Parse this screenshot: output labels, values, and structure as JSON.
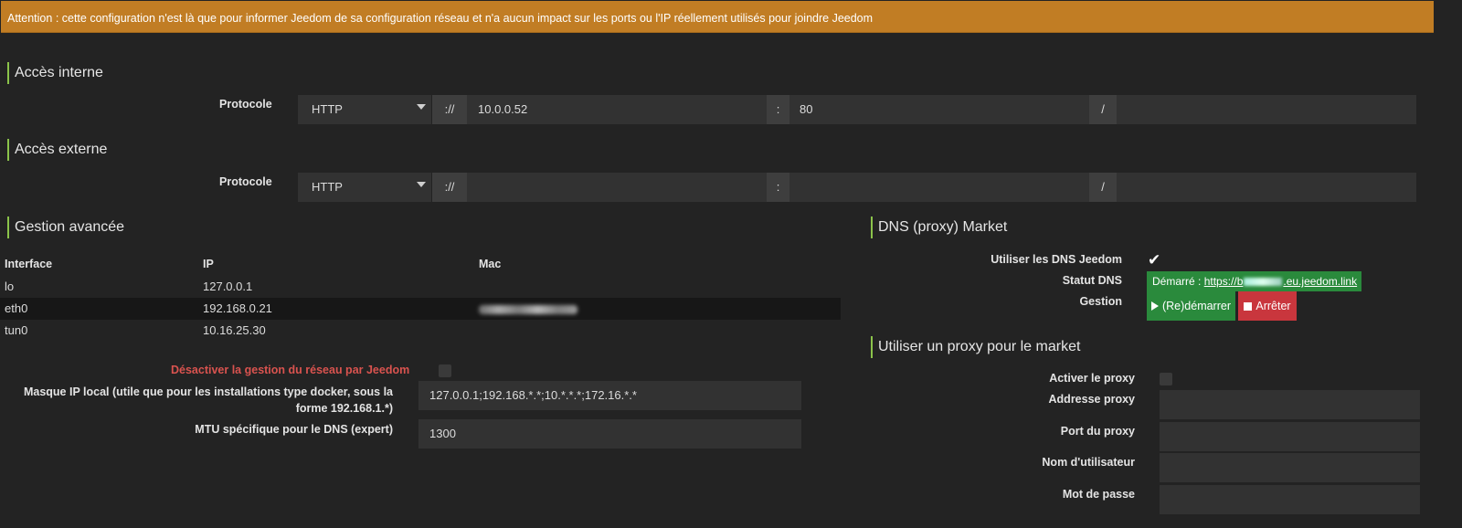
{
  "alert": {
    "text": "Attention : cette configuration n'est là que pour informer Jeedom de sa configuration réseau et n'a aucun impact sur les ports ou l'IP réellement utilisés pour joindre Jeedom"
  },
  "internal": {
    "title": "Accès interne",
    "protocol_label": "Protocole",
    "protocol": "HTTP",
    "sep_scheme": "://",
    "ip": "10.0.0.52",
    "sep_port": ":",
    "port": "80",
    "sep_path": "/",
    "path": ""
  },
  "external": {
    "title": "Accès externe",
    "protocol_label": "Protocole",
    "protocol": "HTTP",
    "sep_scheme": "://",
    "ip": "",
    "sep_port": ":",
    "port": "",
    "sep_path": "/",
    "path": ""
  },
  "advanced": {
    "title": "Gestion avancée",
    "columns": [
      "Interface",
      "IP",
      "Mac"
    ],
    "rows": [
      {
        "interface": "lo",
        "ip": "127.0.0.1",
        "mac": ""
      },
      {
        "interface": "eth0",
        "ip": "192.168.0.21",
        "mac": ""
      },
      {
        "interface": "tun0",
        "ip": "10.16.25.30",
        "mac": ""
      }
    ],
    "disable_label": "Désactiver la gestion du réseau par Jeedom",
    "mask_label_line1": "Masque IP local (utile que pour les installations type docker, sous la",
    "mask_label_line2": "forme 192.168.1.*)",
    "mask_value": "127.0.0.1;192.168.*.*;10.*.*.*;172.16.*.*",
    "mtu_label": "MTU spécifique pour le DNS (expert)",
    "mtu_value": "1300"
  },
  "dns": {
    "title": "DNS (proxy) Market",
    "use_dns_label": "Utiliser les DNS Jeedom",
    "status_label": "Statut DNS",
    "status_prefix": "Démarré : ",
    "status_link_start": "https://b",
    "status_link_end": ".eu.jeedom.link",
    "manage_label": "Gestion",
    "restart_label": "(Re)démarrer",
    "stop_label": "Arrêter"
  },
  "proxy": {
    "title": "Utiliser un proxy pour le market",
    "enable_label": "Activer le proxy",
    "address_label": "Addresse proxy",
    "port_label": "Port du proxy",
    "user_label": "Nom d'utilisateur",
    "password_label": "Mot de passe"
  }
}
